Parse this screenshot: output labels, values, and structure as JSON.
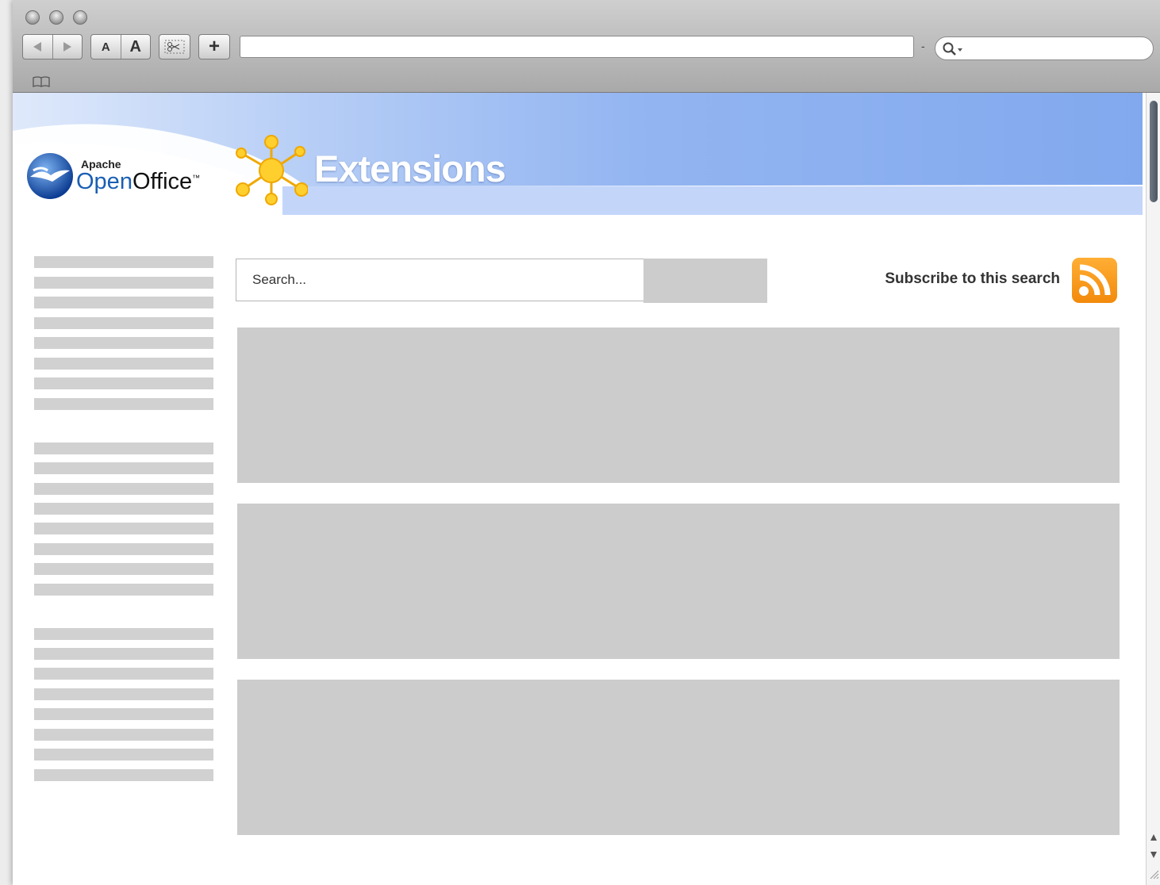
{
  "window": {
    "title": ""
  },
  "toolbar": {
    "font_small_label": "A",
    "font_large_label": "A",
    "add_label": "+",
    "url_value": "",
    "search_value": "",
    "url_separator": "-"
  },
  "header": {
    "logo_small": "Apache",
    "logo_open": "Open",
    "logo_office": "Office",
    "logo_tm": "™",
    "title": "Extensions"
  },
  "search": {
    "placeholder": "Search...",
    "button_label": ""
  },
  "subscribe": {
    "label": "Subscribe to this search"
  },
  "colors": {
    "banner_blue": "#82a9ee",
    "rss_orange": "#f28a0b",
    "placeholder_gray": "#cccccc",
    "logo_blue": "#1a5fb4",
    "star_yellow": "#ffcf2e"
  }
}
